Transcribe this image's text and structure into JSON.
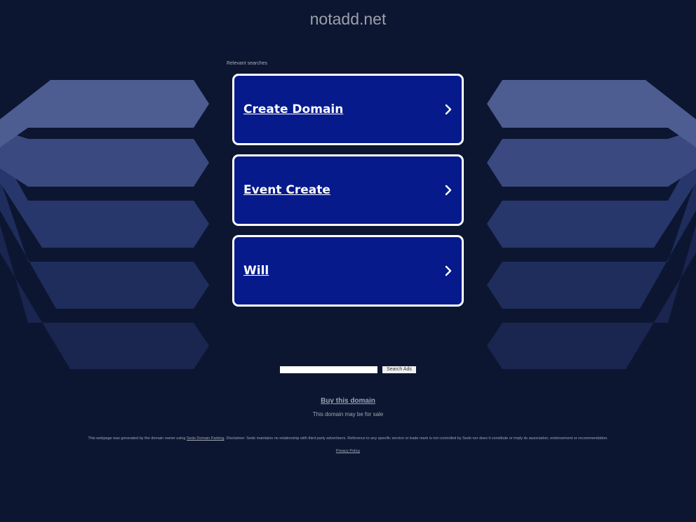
{
  "domain_title": "notadd.net",
  "relevant_searches_label": "Relevant searches",
  "search_links": [
    {
      "label": "Create Domain",
      "icon": "chevron-right-icon"
    },
    {
      "label": "Event Create",
      "icon": "chevron-right-icon"
    },
    {
      "label": "Will",
      "icon": "chevron-right-icon"
    }
  ],
  "search": {
    "input_value": "",
    "button_label": "Search Ads"
  },
  "buy": {
    "link_label": "Buy this domain",
    "subtext": "This domain may be for sale"
  },
  "disclaimer": {
    "prefix": "This webpage was generated by the domain owner using ",
    "link_label": "Sedo Domain Parking",
    "suffix": ". Disclaimer: Sedo maintains no relationship with third party advertisers. Reference to any specific service or trade mark is not controlled by Sedo nor does it constitute or imply its association, endorsement or recommendation."
  },
  "privacy_label": "Privacy Policy",
  "colors": {
    "background": "#0d1631",
    "card_fill": "#061a8c",
    "card_border": "#ffffff",
    "title_text": "#9aa0ab"
  }
}
